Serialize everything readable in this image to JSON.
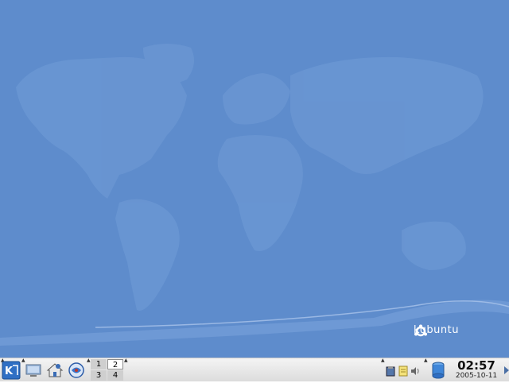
{
  "desktop": {
    "background_color": "#5e8ccc",
    "wallpaper": "world-map",
    "brand_text": "kubuntu"
  },
  "panel": {
    "launchers": [
      {
        "name": "kmenu",
        "icon": "k-menu-icon"
      },
      {
        "name": "show-desktop",
        "icon": "desktop-icon"
      },
      {
        "name": "file-manager",
        "icon": "home-icon"
      },
      {
        "name": "browser",
        "icon": "konqueror-icon"
      }
    ],
    "pager": {
      "desktops": [
        "1",
        "2",
        "3",
        "4"
      ],
      "active": "2"
    },
    "tray": {
      "icons": [
        "klipper-icon",
        "notes-icon",
        "volume-icon",
        "storage-icon"
      ]
    },
    "clock": {
      "time": "02:57",
      "date": "2005-10-11"
    }
  }
}
